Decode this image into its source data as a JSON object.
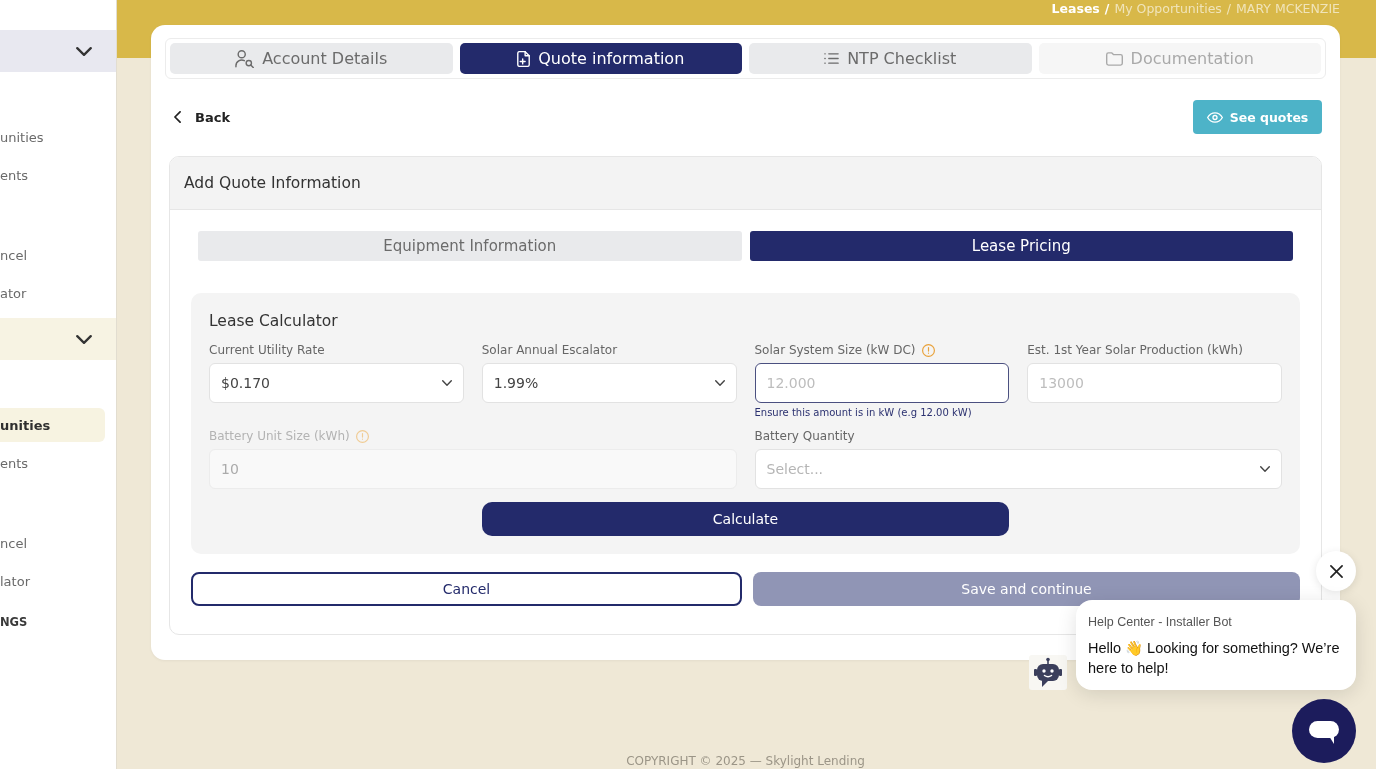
{
  "sidebar": {
    "groups": [
      {
        "expanded": true,
        "color": "#e8e8f0",
        "items": [
          {
            "label": "unities",
            "selected": false
          },
          {
            "label": "ents",
            "selected": false
          },
          {
            "label": "ncel",
            "selected": false
          },
          {
            "label": "ator",
            "selected": false
          }
        ]
      },
      {
        "expanded": true,
        "color": "#f7f3e3",
        "items": [
          {
            "label": "unities",
            "selected": true
          },
          {
            "label": "ents",
            "selected": false
          },
          {
            "label": "ncel",
            "selected": false
          },
          {
            "label": "lator",
            "selected": false
          }
        ]
      }
    ],
    "section_label": "NGS"
  },
  "breadcrumb": [
    {
      "label": "Leases",
      "separator": "/",
      "emphasized": true
    },
    {
      "label": "My Opportunities",
      "separator": "/",
      "emphasized": false
    },
    {
      "label": "MARY MCKENZIE",
      "emphasized": false
    }
  ],
  "tabs": [
    {
      "label": "Account Details",
      "selected": false,
      "disabled": false
    },
    {
      "label": "Quote information",
      "selected": true,
      "disabled": false
    },
    {
      "label": "NTP Checklist",
      "selected": false,
      "disabled": false
    },
    {
      "label": "Documentation",
      "selected": false,
      "disabled": true
    }
  ],
  "back": {
    "label": "Back"
  },
  "see_quotes": {
    "label": "See quotes"
  },
  "quote_section": {
    "title": "Add Quote Information",
    "subtabs": [
      {
        "label": "Equipment Information",
        "selected": false
      },
      {
        "label": "Lease Pricing",
        "selected": true
      }
    ],
    "calculator": {
      "title": "Lease Calculator",
      "rows": [
        {
          "fields": [
            {
              "kind": "select",
              "label": "Current Utility Rate",
              "info": false,
              "value": "$0.170",
              "focused": false,
              "disabled": false
            },
            {
              "kind": "select",
              "label": "Solar Annual Escalator",
              "info": false,
              "value": "1.99%",
              "focused": false,
              "disabled": false
            },
            {
              "kind": "input",
              "label": "Solar System Size (kW DC)",
              "info": true,
              "placeholder": "12.000",
              "focused": true,
              "disabled": false,
              "hint": "Ensure this amount is in kW (e.g 12.00 kW)"
            },
            {
              "kind": "input",
              "label": "Est. 1st Year Solar Production (kWh)",
              "info": false,
              "placeholder": "13000",
              "focused": false,
              "disabled": false
            }
          ]
        },
        {
          "fields": [
            {
              "kind": "input",
              "label": "Battery Unit Size (kWh)",
              "info": true,
              "value": "10",
              "focused": false,
              "disabled": true
            },
            {
              "kind": "select",
              "label": "Battery Quantity",
              "info": false,
              "placeholder": "Select...",
              "focused": false,
              "disabled": false
            }
          ]
        }
      ],
      "button": "Calculate"
    },
    "actions": [
      {
        "label": "Cancel",
        "kind": "outline",
        "disabled": false
      },
      {
        "label": "Save and continue",
        "kind": "primary",
        "disabled": true
      }
    ]
  },
  "chat": {
    "sender": "Help Center - Installer Bot",
    "message": "Hello 👋 Looking for something? We’re here to help!"
  },
  "footer": {
    "copyright": "COPYRIGHT © 2025 — Skylight Lending"
  }
}
